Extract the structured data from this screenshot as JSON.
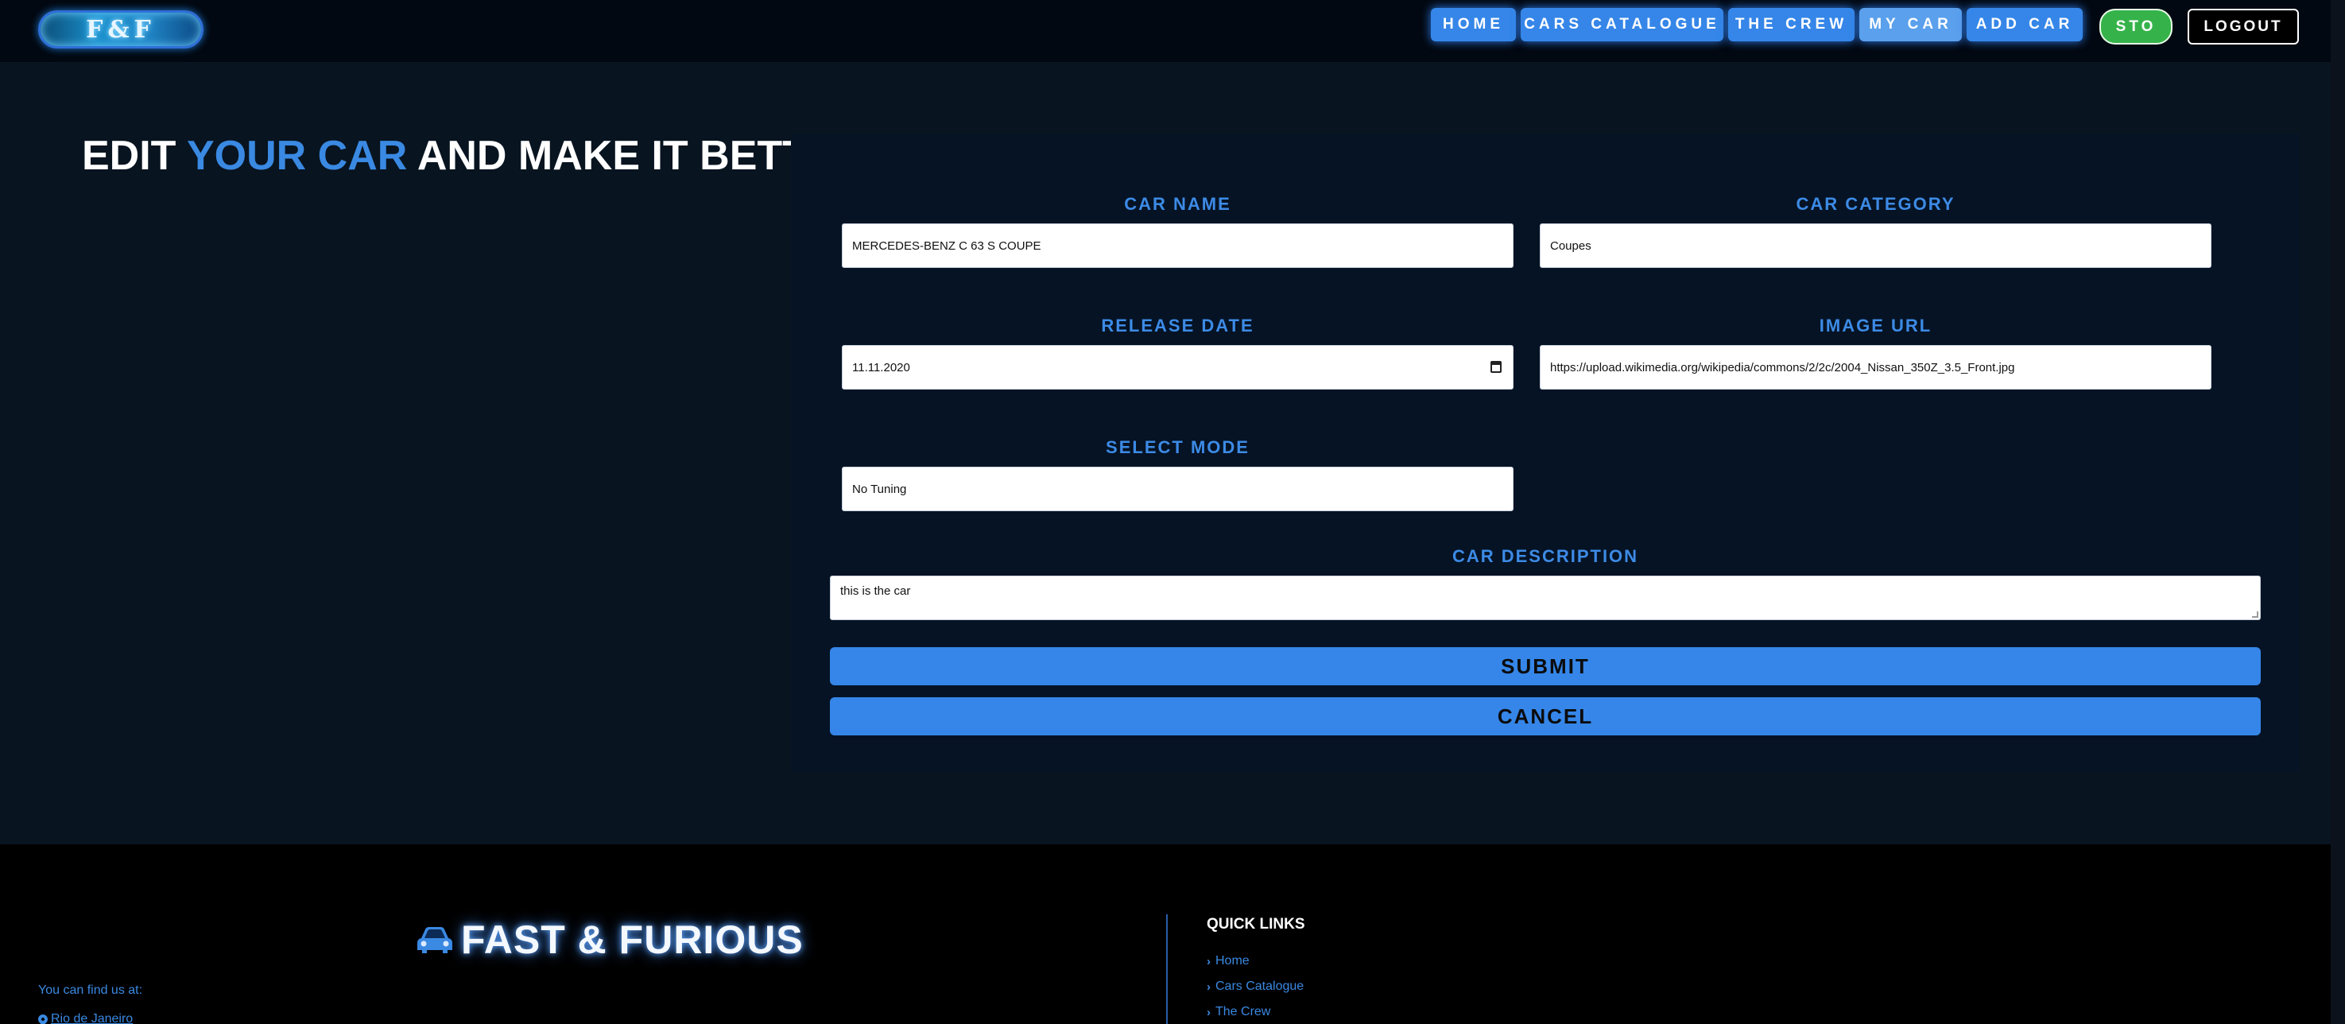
{
  "nav": {
    "logo_text": "F&F",
    "links": [
      "HOME",
      "CARS CATALOGUE",
      "THE CREW",
      "MY CAR",
      "ADD CAR"
    ],
    "sto_label": "STO",
    "logout_label": "LOGOUT"
  },
  "heading": {
    "part1": "EDIT ",
    "accent": "YOUR CAR",
    "part2": " AND MAKE IT BETTER"
  },
  "form": {
    "car_name_label": "CAR NAME",
    "car_name_value": "MERCEDES-BENZ C 63 S COUPE",
    "car_category_label": "CAR CATEGORY",
    "car_category_value": "Coupes",
    "release_date_label": "RELEASE DATE",
    "release_date_value": "11.11.2020",
    "image_url_label": "IMAGE URL",
    "image_url_value": "https://upload.wikimedia.org/wikipedia/commons/2/2c/2004_Nissan_350Z_3.5_Front.jpg",
    "select_mode_label": "SELECT MODE",
    "select_mode_value": "No Tuning",
    "description_label": "CAR DESCRIPTION",
    "description_value": "this is the car",
    "submit_label": "SUBMIT",
    "cancel_label": "CANCEL"
  },
  "footer": {
    "brand": "FAST & FURIOUS",
    "find_us": "You can find us at:",
    "location": "Rio de Janeiro",
    "quick_links_title": "QUICK LINKS",
    "quick_links": [
      "Home",
      "Cars Catalogue",
      "The Crew"
    ]
  },
  "colors": {
    "accent": "#3a89e2",
    "nav_button": "#3586e8",
    "sto_green": "#35b34a",
    "panel_bg": "#051325",
    "page_bg": "#081420"
  }
}
